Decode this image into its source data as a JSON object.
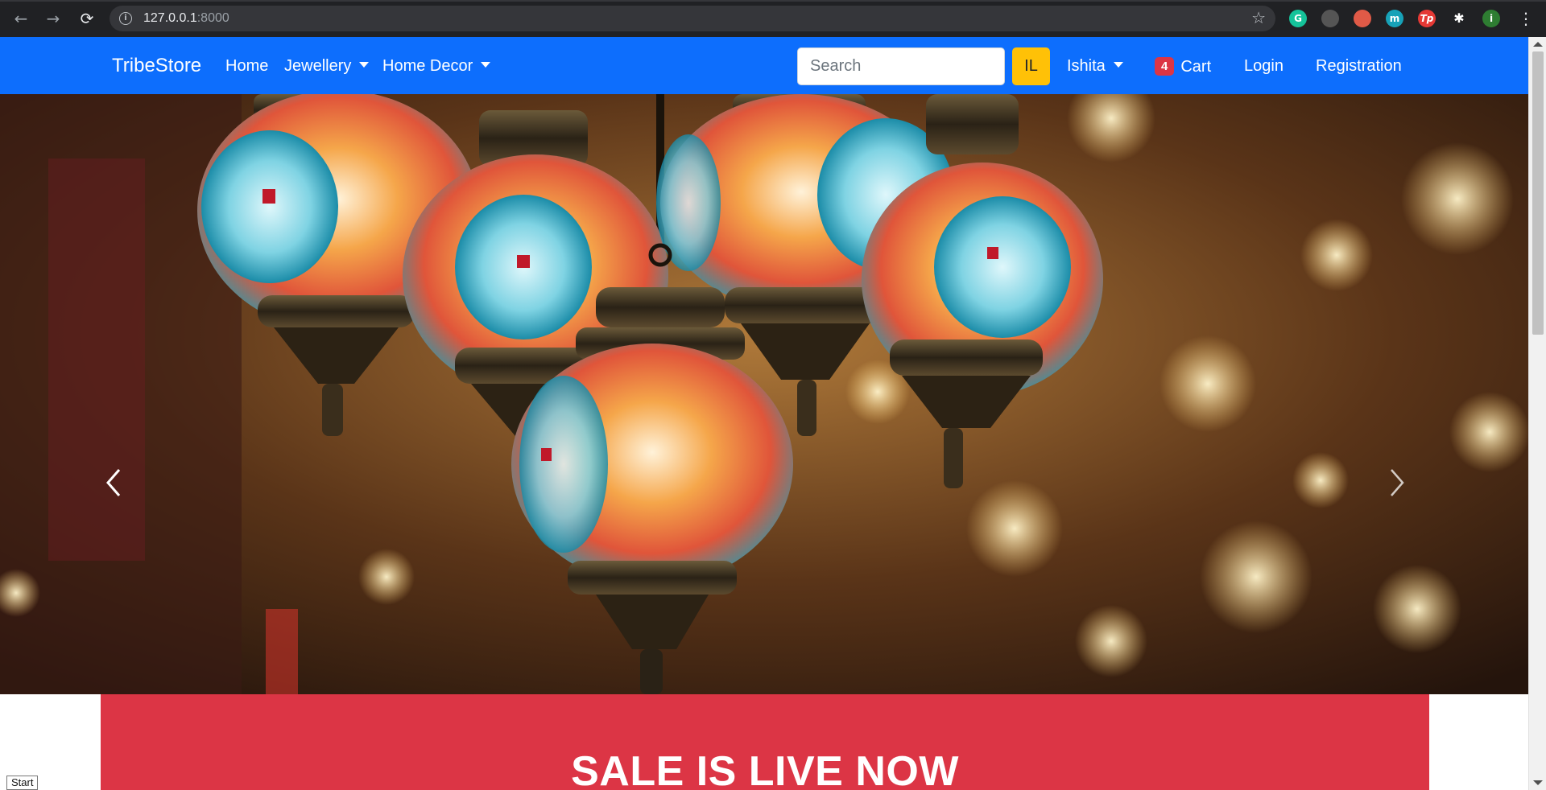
{
  "browser": {
    "url_host": "127.0.0.1",
    "url_port": ":8000",
    "back_glyph": "←",
    "forward_glyph": "→",
    "reload_glyph": "⟳",
    "info_glyph": "i",
    "star_glyph": "☆",
    "extensions": [
      {
        "label": "G",
        "color": "#15c39a"
      },
      {
        "label": "",
        "color": "#555555"
      },
      {
        "label": "",
        "color": "#e05a47"
      },
      {
        "label": "m",
        "color": "#17a2b8"
      },
      {
        "label": "Tp",
        "color": "#e53935"
      },
      {
        "label": "✱",
        "color": "#202124"
      },
      {
        "label": "i",
        "color": "#2e7d32"
      }
    ],
    "menu_glyph": "⋮"
  },
  "navbar": {
    "brand": "TribeStore",
    "home": "Home",
    "jewellery": "Jewellery",
    "home_decor": "Home Decor",
    "search_placeholder": "Search",
    "il_button": "IL",
    "user": "Ishita",
    "cart_count": "4",
    "cart": "Cart",
    "login": "Login",
    "registration": "Registration",
    "colors": {
      "bar": "#0d6efd",
      "il_button": "#ffc107",
      "badge": "#dc3545"
    }
  },
  "carousel": {
    "prev_icon": "chevron-left-icon",
    "next_icon": "chevron-right-icon"
  },
  "sale_banner": {
    "heading": "SALE IS LIVE NOW",
    "color": "#dc3545"
  },
  "status": {
    "start_label": "Start"
  }
}
